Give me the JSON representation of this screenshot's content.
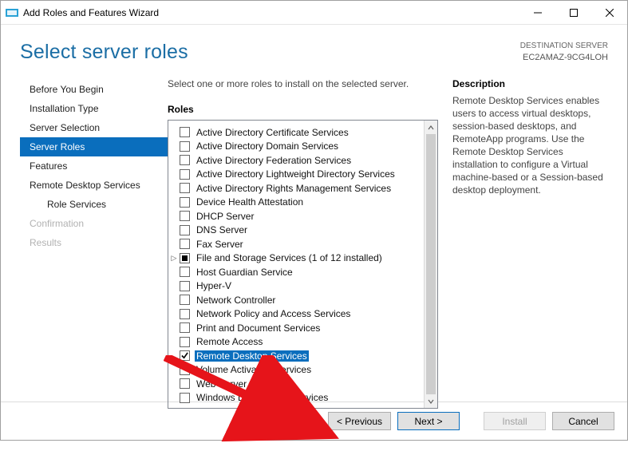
{
  "window": {
    "title": "Add Roles and Features Wizard"
  },
  "header": {
    "heading": "Select server roles",
    "destination_label": "DESTINATION SERVER",
    "destination_value": "EC2AMAZ-9CG4LOH"
  },
  "nav": {
    "items": [
      {
        "label": "Before You Begin",
        "state": "normal"
      },
      {
        "label": "Installation Type",
        "state": "normal"
      },
      {
        "label": "Server Selection",
        "state": "normal"
      },
      {
        "label": "Server Roles",
        "state": "selected"
      },
      {
        "label": "Features",
        "state": "normal"
      },
      {
        "label": "Remote Desktop Services",
        "state": "normal"
      },
      {
        "label": "Role Services",
        "state": "normal",
        "indent": true
      },
      {
        "label": "Confirmation",
        "state": "disabled"
      },
      {
        "label": "Results",
        "state": "disabled"
      }
    ]
  },
  "main": {
    "intro": "Select one or more roles to install on the selected server.",
    "roles_label": "Roles",
    "description_label": "Description",
    "description_text": "Remote Desktop Services enables users to access virtual desktops, session-based desktops, and RemoteApp programs. Use the Remote Desktop Services installation to configure a Virtual machine-based or a Session-based desktop deployment.",
    "roles": [
      {
        "label": "Active Directory Certificate Services",
        "checked": false
      },
      {
        "label": "Active Directory Domain Services",
        "checked": false
      },
      {
        "label": "Active Directory Federation Services",
        "checked": false
      },
      {
        "label": "Active Directory Lightweight Directory Services",
        "checked": false
      },
      {
        "label": "Active Directory Rights Management Services",
        "checked": false
      },
      {
        "label": "Device Health Attestation",
        "checked": false
      },
      {
        "label": "DHCP Server",
        "checked": false
      },
      {
        "label": "DNS Server",
        "checked": false
      },
      {
        "label": "Fax Server",
        "checked": false
      },
      {
        "label": "File and Storage Services (1 of 12 installed)",
        "checked": "partial",
        "expander": true
      },
      {
        "label": "Host Guardian Service",
        "checked": false
      },
      {
        "label": "Hyper-V",
        "checked": false
      },
      {
        "label": "Network Controller",
        "checked": false
      },
      {
        "label": "Network Policy and Access Services",
        "checked": false
      },
      {
        "label": "Print and Document Services",
        "checked": false
      },
      {
        "label": "Remote Access",
        "checked": false
      },
      {
        "label": "Remote Desktop Services",
        "checked": true,
        "highlight": true
      },
      {
        "label": "Volume Activation Services",
        "checked": false
      },
      {
        "label": "Web Server (IIS)",
        "checked": false
      },
      {
        "label": "Windows Deployment Services",
        "checked": false
      }
    ]
  },
  "buttons": {
    "previous": "< Previous",
    "next": "Next >",
    "install": "Install",
    "cancel": "Cancel"
  }
}
